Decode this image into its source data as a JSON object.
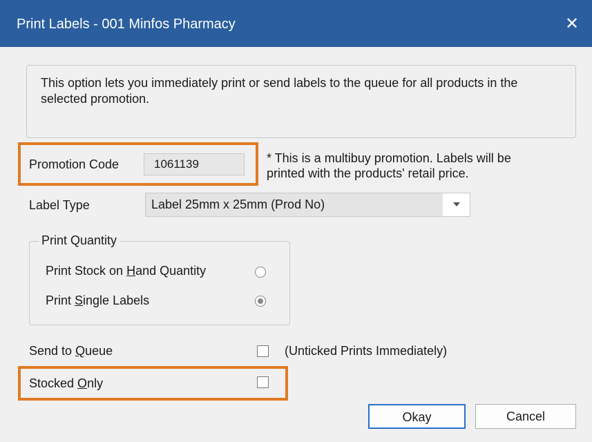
{
  "titlebar": {
    "title": "Print Labels - 001 Minfos Pharmacy",
    "close_glyph": "✕"
  },
  "description": "This option lets you immediately print or send labels to the queue for all products in the selected promotion.",
  "promotion": {
    "label": "Promotion Code",
    "value": "1061139",
    "note": "* This is a multibuy promotion. Labels will be printed with the products' retail price."
  },
  "label_type": {
    "label": "Label Type",
    "value": "Label 25mm x 25mm (Prod No)"
  },
  "print_quantity": {
    "legend": "Print Quantity",
    "soh": {
      "pre": "Print Stock on ",
      "key": "H",
      "post": "and Quantity",
      "selected": false
    },
    "single": {
      "pre": "Print ",
      "key": "S",
      "post": "ingle Labels",
      "selected": true
    }
  },
  "send_to_queue": {
    "pre": "Send to ",
    "key": "Q",
    "post": "ueue",
    "checked": false,
    "hint": "(Unticked Prints Immediately)"
  },
  "stocked_only": {
    "pre": "Stocked ",
    "key": "O",
    "post": "nly",
    "checked": false
  },
  "buttons": {
    "okay": "Okay",
    "cancel": "Cancel"
  },
  "colors": {
    "titlebar": "#2a5e9e",
    "highlight": "#e07b22",
    "default_button_border": "#2a6fc9"
  }
}
